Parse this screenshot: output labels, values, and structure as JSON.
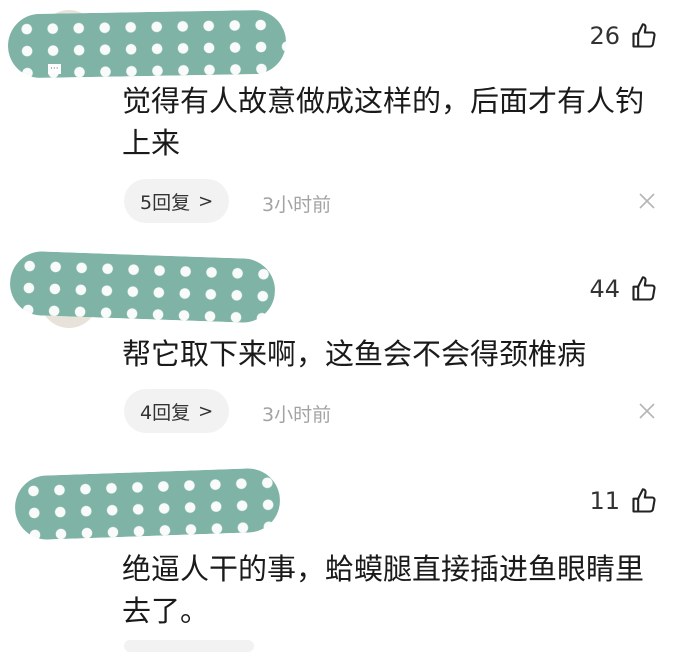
{
  "comments": [
    {
      "likes": "26",
      "text": "觉得有人故意做成这样的，后面才有人钓上来",
      "reply_label": "5回复",
      "time": "3小时前"
    },
    {
      "likes": "44",
      "text": "帮它取下来啊，这鱼会不会得颈椎病",
      "reply_label": "4回复",
      "time": "3小时前"
    },
    {
      "likes": "11",
      "text": "绝逼人干的事，蛤蟆腿直接插进鱼眼睛里去了。"
    }
  ],
  "icons": {
    "like": "thumbs-up-icon",
    "close": "close-icon",
    "chevron": "chevron-right-icon"
  },
  "colors": {
    "censor_blob": "#7fb3a6",
    "time_text": "#a3a3a3",
    "reply_bg": "#f2f2f2"
  }
}
